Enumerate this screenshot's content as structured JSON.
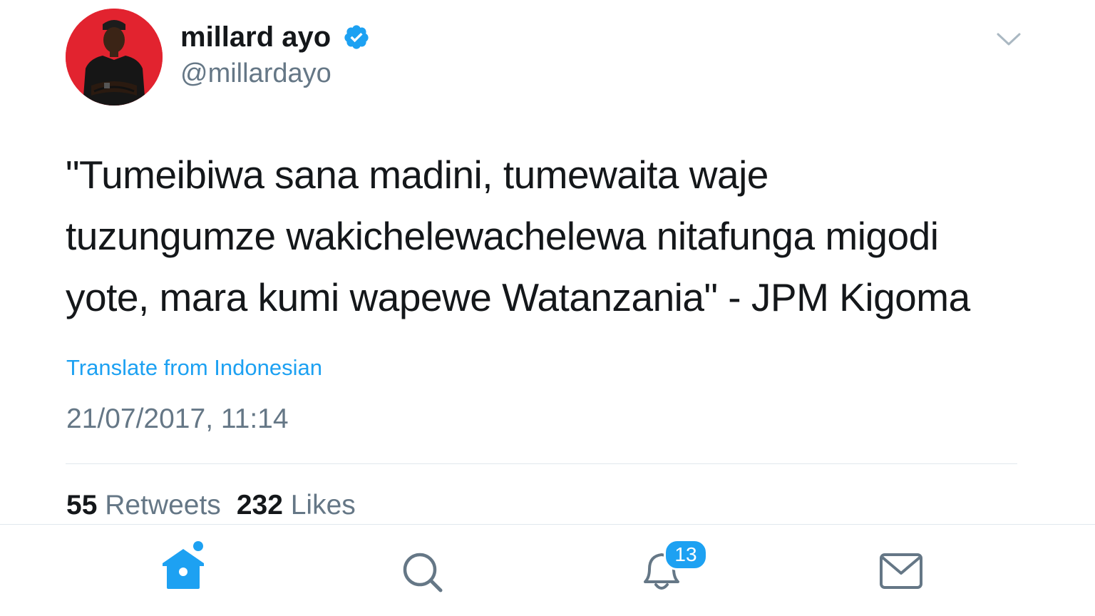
{
  "colors": {
    "accent": "#1da1f2",
    "text_primary": "#14171a",
    "text_secondary": "#657786",
    "avatar_bg": "#e2232f"
  },
  "tweet": {
    "author": {
      "display_name": "millard ayo",
      "handle": "@millardayo",
      "verified": true,
      "avatar_icon": "profile-photo"
    },
    "text_lines": [
      "\"Tumeibiwa sana madini, tumewaita waje",
      "tuzungumze wakichelewachelewa nitafunga migodi",
      "yote, mara kumi wapewe Watanzania\" - JPM Kigoma"
    ],
    "translate_label": "Translate from Indonesian",
    "timestamp": "21/07/2017, 11:14",
    "stats": {
      "retweets_count": "55",
      "retweets_label": "Retweets",
      "likes_count": "232",
      "likes_label": "Likes"
    },
    "menu_icon": "chevron-down-icon"
  },
  "tabbar": {
    "tabs": [
      {
        "name": "home",
        "icon": "home-icon",
        "active": true,
        "has_dot": true
      },
      {
        "name": "search",
        "icon": "search-icon",
        "active": false
      },
      {
        "name": "notifications",
        "icon": "bell-icon",
        "active": false,
        "badge": "13"
      },
      {
        "name": "messages",
        "icon": "envelope-icon",
        "active": false
      }
    ]
  }
}
